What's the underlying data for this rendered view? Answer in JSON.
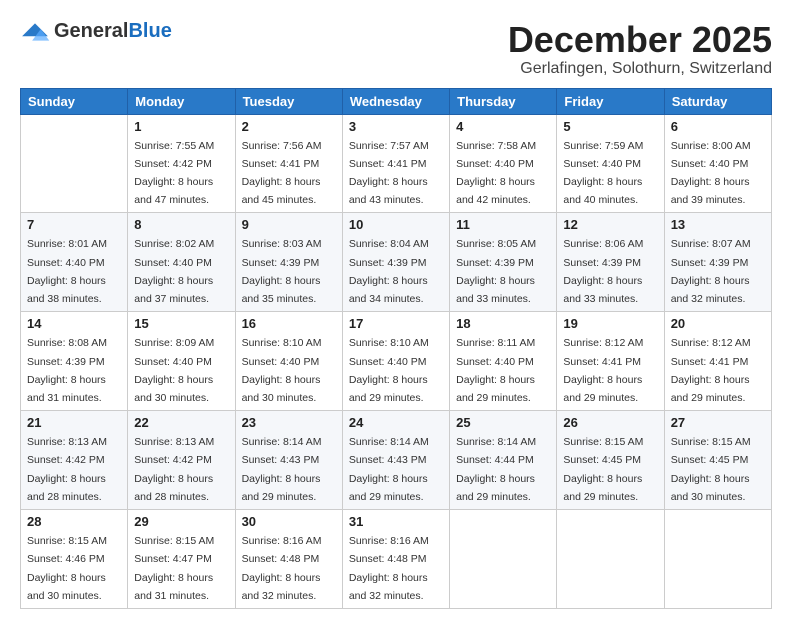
{
  "header": {
    "logo_general": "General",
    "logo_blue": "Blue",
    "month": "December 2025",
    "location": "Gerlafingen, Solothurn, Switzerland"
  },
  "weekdays": [
    "Sunday",
    "Monday",
    "Tuesday",
    "Wednesday",
    "Thursday",
    "Friday",
    "Saturday"
  ],
  "weeks": [
    [
      {
        "day": "",
        "sunrise": "",
        "sunset": "",
        "daylight": ""
      },
      {
        "day": "1",
        "sunrise": "Sunrise: 7:55 AM",
        "sunset": "Sunset: 4:42 PM",
        "daylight": "Daylight: 8 hours and 47 minutes."
      },
      {
        "day": "2",
        "sunrise": "Sunrise: 7:56 AM",
        "sunset": "Sunset: 4:41 PM",
        "daylight": "Daylight: 8 hours and 45 minutes."
      },
      {
        "day": "3",
        "sunrise": "Sunrise: 7:57 AM",
        "sunset": "Sunset: 4:41 PM",
        "daylight": "Daylight: 8 hours and 43 minutes."
      },
      {
        "day": "4",
        "sunrise": "Sunrise: 7:58 AM",
        "sunset": "Sunset: 4:40 PM",
        "daylight": "Daylight: 8 hours and 42 minutes."
      },
      {
        "day": "5",
        "sunrise": "Sunrise: 7:59 AM",
        "sunset": "Sunset: 4:40 PM",
        "daylight": "Daylight: 8 hours and 40 minutes."
      },
      {
        "day": "6",
        "sunrise": "Sunrise: 8:00 AM",
        "sunset": "Sunset: 4:40 PM",
        "daylight": "Daylight: 8 hours and 39 minutes."
      }
    ],
    [
      {
        "day": "7",
        "sunrise": "Sunrise: 8:01 AM",
        "sunset": "Sunset: 4:40 PM",
        "daylight": "Daylight: 8 hours and 38 minutes."
      },
      {
        "day": "8",
        "sunrise": "Sunrise: 8:02 AM",
        "sunset": "Sunset: 4:40 PM",
        "daylight": "Daylight: 8 hours and 37 minutes."
      },
      {
        "day": "9",
        "sunrise": "Sunrise: 8:03 AM",
        "sunset": "Sunset: 4:39 PM",
        "daylight": "Daylight: 8 hours and 35 minutes."
      },
      {
        "day": "10",
        "sunrise": "Sunrise: 8:04 AM",
        "sunset": "Sunset: 4:39 PM",
        "daylight": "Daylight: 8 hours and 34 minutes."
      },
      {
        "day": "11",
        "sunrise": "Sunrise: 8:05 AM",
        "sunset": "Sunset: 4:39 PM",
        "daylight": "Daylight: 8 hours and 33 minutes."
      },
      {
        "day": "12",
        "sunrise": "Sunrise: 8:06 AM",
        "sunset": "Sunset: 4:39 PM",
        "daylight": "Daylight: 8 hours and 33 minutes."
      },
      {
        "day": "13",
        "sunrise": "Sunrise: 8:07 AM",
        "sunset": "Sunset: 4:39 PM",
        "daylight": "Daylight: 8 hours and 32 minutes."
      }
    ],
    [
      {
        "day": "14",
        "sunrise": "Sunrise: 8:08 AM",
        "sunset": "Sunset: 4:39 PM",
        "daylight": "Daylight: 8 hours and 31 minutes."
      },
      {
        "day": "15",
        "sunrise": "Sunrise: 8:09 AM",
        "sunset": "Sunset: 4:40 PM",
        "daylight": "Daylight: 8 hours and 30 minutes."
      },
      {
        "day": "16",
        "sunrise": "Sunrise: 8:10 AM",
        "sunset": "Sunset: 4:40 PM",
        "daylight": "Daylight: 8 hours and 30 minutes."
      },
      {
        "day": "17",
        "sunrise": "Sunrise: 8:10 AM",
        "sunset": "Sunset: 4:40 PM",
        "daylight": "Daylight: 8 hours and 29 minutes."
      },
      {
        "day": "18",
        "sunrise": "Sunrise: 8:11 AM",
        "sunset": "Sunset: 4:40 PM",
        "daylight": "Daylight: 8 hours and 29 minutes."
      },
      {
        "day": "19",
        "sunrise": "Sunrise: 8:12 AM",
        "sunset": "Sunset: 4:41 PM",
        "daylight": "Daylight: 8 hours and 29 minutes."
      },
      {
        "day": "20",
        "sunrise": "Sunrise: 8:12 AM",
        "sunset": "Sunset: 4:41 PM",
        "daylight": "Daylight: 8 hours and 29 minutes."
      }
    ],
    [
      {
        "day": "21",
        "sunrise": "Sunrise: 8:13 AM",
        "sunset": "Sunset: 4:42 PM",
        "daylight": "Daylight: 8 hours and 28 minutes."
      },
      {
        "day": "22",
        "sunrise": "Sunrise: 8:13 AM",
        "sunset": "Sunset: 4:42 PM",
        "daylight": "Daylight: 8 hours and 28 minutes."
      },
      {
        "day": "23",
        "sunrise": "Sunrise: 8:14 AM",
        "sunset": "Sunset: 4:43 PM",
        "daylight": "Daylight: 8 hours and 29 minutes."
      },
      {
        "day": "24",
        "sunrise": "Sunrise: 8:14 AM",
        "sunset": "Sunset: 4:43 PM",
        "daylight": "Daylight: 8 hours and 29 minutes."
      },
      {
        "day": "25",
        "sunrise": "Sunrise: 8:14 AM",
        "sunset": "Sunset: 4:44 PM",
        "daylight": "Daylight: 8 hours and 29 minutes."
      },
      {
        "day": "26",
        "sunrise": "Sunrise: 8:15 AM",
        "sunset": "Sunset: 4:45 PM",
        "daylight": "Daylight: 8 hours and 29 minutes."
      },
      {
        "day": "27",
        "sunrise": "Sunrise: 8:15 AM",
        "sunset": "Sunset: 4:45 PM",
        "daylight": "Daylight: 8 hours and 30 minutes."
      }
    ],
    [
      {
        "day": "28",
        "sunrise": "Sunrise: 8:15 AM",
        "sunset": "Sunset: 4:46 PM",
        "daylight": "Daylight: 8 hours and 30 minutes."
      },
      {
        "day": "29",
        "sunrise": "Sunrise: 8:15 AM",
        "sunset": "Sunset: 4:47 PM",
        "daylight": "Daylight: 8 hours and 31 minutes."
      },
      {
        "day": "30",
        "sunrise": "Sunrise: 8:16 AM",
        "sunset": "Sunset: 4:48 PM",
        "daylight": "Daylight: 8 hours and 32 minutes."
      },
      {
        "day": "31",
        "sunrise": "Sunrise: 8:16 AM",
        "sunset": "Sunset: 4:48 PM",
        "daylight": "Daylight: 8 hours and 32 minutes."
      },
      {
        "day": "",
        "sunrise": "",
        "sunset": "",
        "daylight": ""
      },
      {
        "day": "",
        "sunrise": "",
        "sunset": "",
        "daylight": ""
      },
      {
        "day": "",
        "sunrise": "",
        "sunset": "",
        "daylight": ""
      }
    ]
  ]
}
